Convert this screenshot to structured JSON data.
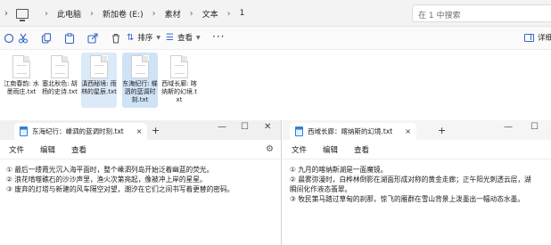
{
  "explorer": {
    "breadcrumb": [
      "此电脑",
      "新加卷 (E:)",
      "素材",
      "文本",
      "1"
    ],
    "search_placeholder": "在 1 中搜索",
    "toolbar": {
      "sort_label": "排序",
      "view_label": "查看",
      "more_label": "···",
      "details_label": "详细信息"
    },
    "files": [
      {
        "name": "江南春韵: 水墨雨庄.txt"
      },
      {
        "name": "塞北秋色: 胡杨的史诗.txt"
      },
      {
        "name": "滇西秘境: 雨林的星辰.txt"
      },
      {
        "name": "东海纪行: 蝶泗的蓝调时刻.txt"
      },
      {
        "name": "西域长廊: 喀纳斯的幻境.txt"
      }
    ]
  },
  "notepad_left": {
    "tab_title": "东海纪行：嵊泗的蓝调时刻.txt",
    "close_tab": "×",
    "new_tab": "+",
    "menu": [
      "文件",
      "编辑",
      "查看"
    ],
    "lines": [
      "① 最后一缕霞光沉入海平面时，整个嵊泗列岛开始泛着幽蓝的荧光。",
      "② 浪花啃噬礁石的沙沙声里，渔火次第亮起，像被冲上岸的星星。",
      "③ 废弃的灯塔与新建的风车隔空对望，潮汐在它们之间书写着更替的密码。"
    ]
  },
  "notepad_right": {
    "tab_title": "西域长廊：喀纳斯的幻境.txt",
    "close_tab": "×",
    "new_tab": "+",
    "menu": [
      "文件",
      "编辑",
      "查看"
    ],
    "lines": [
      "① 九月的喀纳斯湖是一面魔镜。",
      "② 晨雾弥漫时，白桦林倒影在湖面形成对称的黄金走廊；正午阳光刺透云层，湖",
      "瞬间化作液态翡翠。",
      "③ 牧民策马踏过草甸的刹那，惊飞的雁群在雪山背景上泼墨出一幅动态水墨。"
    ]
  }
}
